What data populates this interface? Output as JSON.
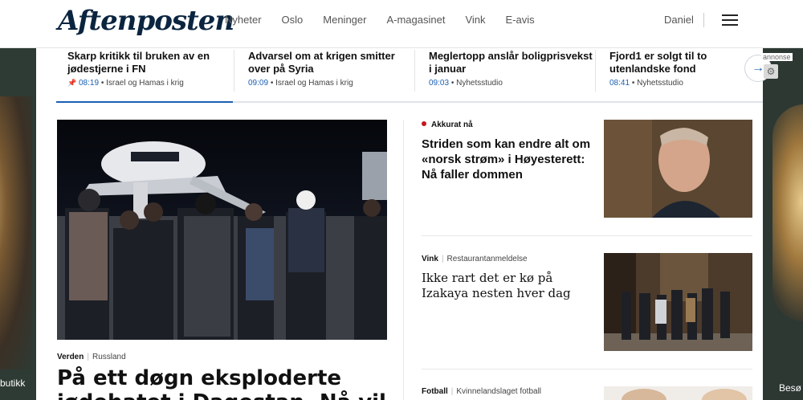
{
  "header": {
    "logo": "Aftenposten",
    "nav": [
      "Nyheter",
      "Oslo",
      "Meninger",
      "A-magasinet",
      "Vink",
      "E-avis"
    ],
    "user_name": "Daniel"
  },
  "ticker": {
    "items": [
      {
        "title": "Skarp kritikk til bruken av en jødestjerne i FN",
        "time": "08:19",
        "section": "Israel og Hamas i krig",
        "pinned": true
      },
      {
        "title": "Advarsel om at krigen smitter over på Syria",
        "time": "09:09",
        "section": "Israel og Hamas i krig",
        "pinned": false
      },
      {
        "title": "Meglertopp anslår boligprisvekst i januar",
        "time": "09:03",
        "section": "Nyhetsstudio",
        "pinned": false
      },
      {
        "title": "Fjord1 er solgt til to utenlandske fond",
        "time": "08:41",
        "section": "Nyhetsstudio",
        "pinned": false
      }
    ],
    "next_icon": "→"
  },
  "ad": {
    "label": "annonse",
    "left_text": "butikk",
    "right_text": "Besø"
  },
  "hero": {
    "section": "Verden",
    "subsection": "Russland",
    "title": "På ett døgn eksploderte jødehatet i Dagestan. Nå vil"
  },
  "stories": [
    {
      "label": "Akkurat nå",
      "sublabel": "",
      "title": "Striden som kan endre alt om «norsk strøm» i Høyesterett: Nå faller dommen",
      "live": true
    },
    {
      "label": "Vink",
      "sublabel": "Restaurantanmeldelse",
      "title": "Ikke rart det er kø på Izakaya nesten hver dag",
      "live": false
    },
    {
      "label": "Fotball",
      "sublabel": "Kvinnelandslaget fotball",
      "title": "",
      "live": false
    }
  ],
  "colors": {
    "brand": "#0b2540",
    "link_blue": "#1a5fb4",
    "live_red": "#c4161c",
    "ad_bg": "#2e3a34"
  }
}
